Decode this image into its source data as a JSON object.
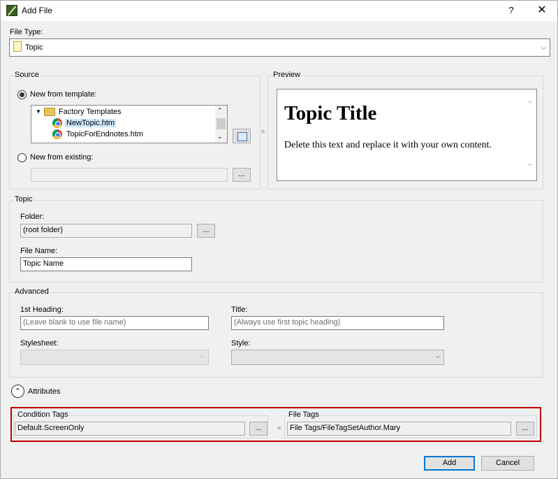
{
  "window": {
    "title": "Add File",
    "help": "?",
    "close": "✕"
  },
  "file_type": {
    "label": "File Type:",
    "value": "Topic",
    "icon": "topic-doc-icon"
  },
  "source": {
    "group_title": "Source",
    "new_from_template": "New from template:",
    "template_tree": {
      "root": "Factory Templates",
      "items": [
        "NewTopic.htm",
        "TopicForEndnotes.htm"
      ],
      "selected": "NewTopic.htm"
    },
    "new_from_existing": "New from existing:",
    "existing_value": "",
    "browse_label": "..."
  },
  "preview": {
    "group_title": "Preview",
    "heading": "Topic Title",
    "body": "Delete this text and replace it with your own content."
  },
  "topic": {
    "group_title": "Topic",
    "folder_label": "Folder:",
    "folder_value": "(root folder)",
    "browse_label": "...",
    "file_name_label": "File Name:",
    "file_name_value": "Topic Name"
  },
  "advanced": {
    "group_title": "Advanced",
    "first_heading_label": "1st Heading:",
    "first_heading_placeholder": "(Leave blank to use file name)",
    "title_label": "Title:",
    "title_placeholder": "(Always use first topic heading)",
    "stylesheet_label": "Stylesheet:",
    "style_label": "Style:"
  },
  "attributes": {
    "label": "Attributes",
    "condition_tags_title": "Condition Tags",
    "condition_tags_value": "Default.ScreenOnly",
    "file_tags_title": "File Tags",
    "file_tags_value": "File Tags/FileTagSetAuthor.Mary",
    "browse_label": "..."
  },
  "footer": {
    "add": "Add",
    "cancel": "Cancel"
  },
  "colors": {
    "highlight_frame": "#c00000",
    "selection": "#cce8ff",
    "default_button_border": "#0078d7"
  }
}
